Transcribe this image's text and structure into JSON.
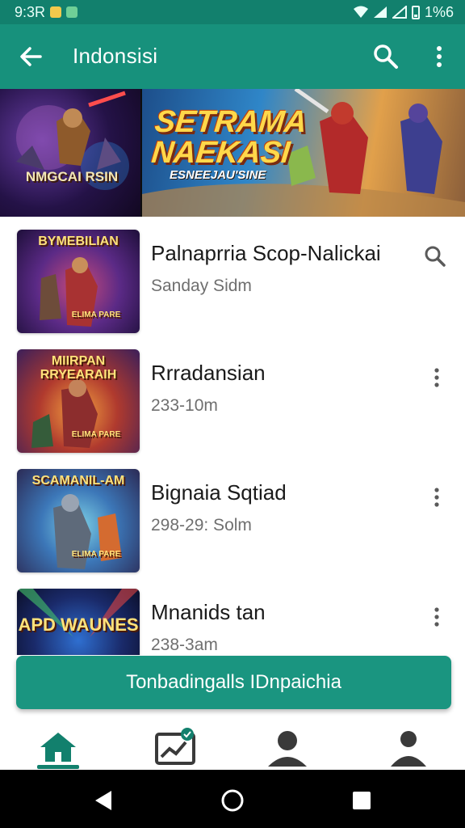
{
  "status_bar": {
    "time": "9:3R",
    "battery": "1%6"
  },
  "app_bar": {
    "title": "Indonsisi"
  },
  "banner": {
    "left_caption": "NMGCAI RSIN",
    "title_line1": "SETRAMA",
    "title_line2": "NAEKASI",
    "subtitle": "ESNEEJAU'SINE"
  },
  "list": {
    "items": [
      {
        "thumb_label": "BYMEBILIAN",
        "thumb_corner": "ELIMA PARE",
        "title": "Palnaprria Scop-Nalickai",
        "subtitle": "Sanday Sidm",
        "action_icon": "search-icon"
      },
      {
        "thumb_label": "MIIRPAN RRYEARAIH",
        "thumb_corner": "ELIMA PARE",
        "title": "Rrradansian",
        "subtitle": "233-10m",
        "action_icon": "more-vert-icon"
      },
      {
        "thumb_label": "SCAMANIL-AM",
        "thumb_corner": "ELIMA PARE",
        "title": "Bignaia Sqtiad",
        "subtitle": "298-29: Solm",
        "action_icon": "more-vert-icon"
      },
      {
        "thumb_label": "APD WAUNES",
        "thumb_corner": "",
        "title": "Mnanids tan",
        "subtitle": "238-3am",
        "action_icon": "more-vert-icon"
      }
    ]
  },
  "cta": {
    "label": "Tonbadingalls IDnpaichia"
  },
  "bottom_nav": {
    "items": [
      {
        "icon": "home-icon",
        "active": true
      },
      {
        "icon": "chart-icon",
        "active": false
      },
      {
        "icon": "profile-icon",
        "active": false
      },
      {
        "icon": "account-icon",
        "active": false
      }
    ]
  },
  "colors": {
    "status_bar": "#12806d",
    "app_bar": "#17917c",
    "accent": "#1a9580",
    "nav_active": "#12806d",
    "nav_inactive": "#3a3a3a"
  }
}
